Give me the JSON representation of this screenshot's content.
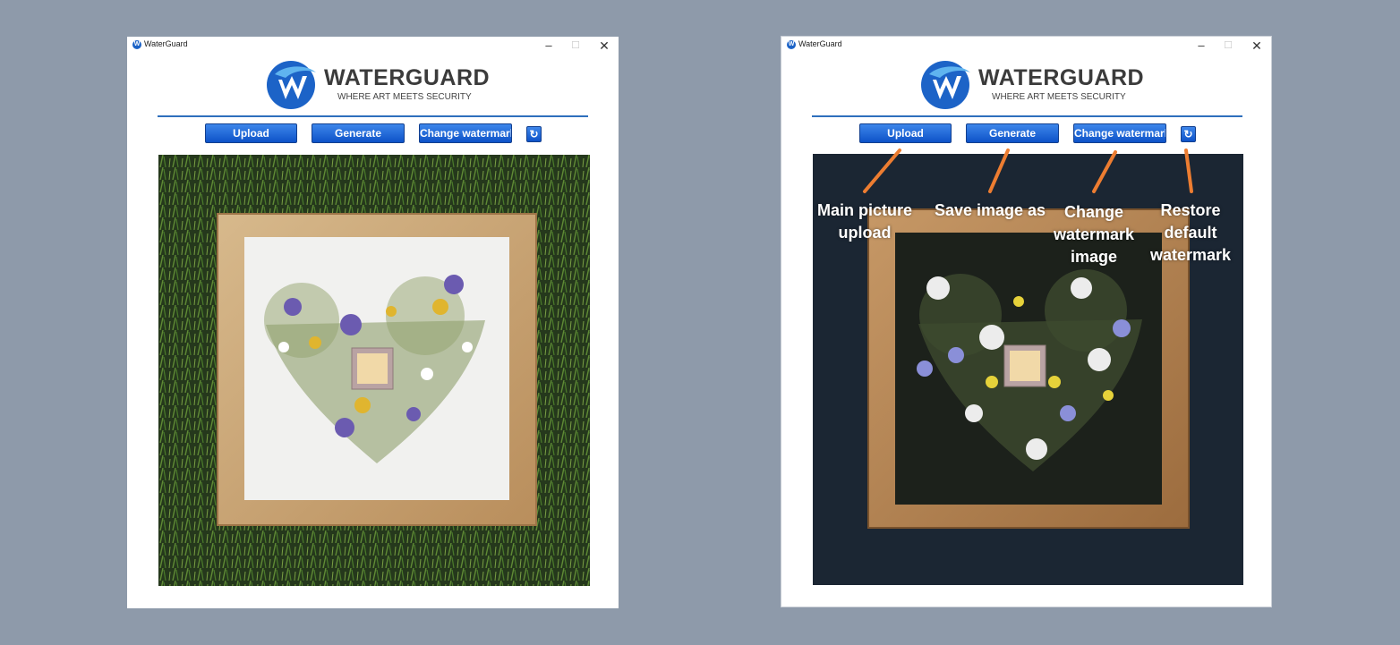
{
  "windows": [
    {
      "title": "WaterGuard",
      "logo": {
        "name": "WATERGUARD",
        "tagline": "WHERE ART MEETS SECURITY"
      },
      "buttons": {
        "upload": "Upload",
        "generate": "Generate",
        "change_watermark": "Change watermark",
        "restore_icon": "↻"
      },
      "photo": {
        "background": "green-grass",
        "mat": "white"
      }
    },
    {
      "title": "WaterGuard",
      "logo": {
        "name": "WATERGUARD",
        "tagline": "WHERE ART MEETS SECURITY"
      },
      "buttons": {
        "upload": "Upload",
        "generate": "Generate",
        "change_watermark": "Change watermark",
        "restore_icon": "↻"
      },
      "photo": {
        "background": "dark-navy",
        "mat": "dark"
      }
    }
  ],
  "annotations": {
    "upload": [
      "Main picture",
      "upload"
    ],
    "generate": [
      "Save image as"
    ],
    "change_watermark": [
      "Change",
      "watermark",
      "image"
    ],
    "restore": [
      "Restore",
      "default",
      "watermark"
    ]
  },
  "colors": {
    "page_background": "#8e9aaa",
    "button_blue": "#1a5fd6",
    "rule_blue": "#2f6fbd",
    "annotation_arrow": "#ed7d31",
    "logo_blue": "#1c63c7"
  }
}
